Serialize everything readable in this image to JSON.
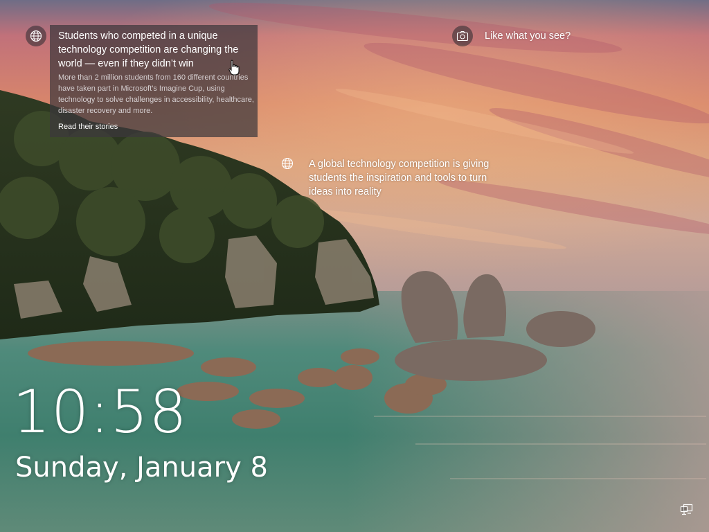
{
  "spotlight": {
    "card": {
      "title": "Students who competed in a unique technology competition are changing the world — even if they didn’t win",
      "body": "More than 2 million students from 160 different countries have taken part in Microsoft’s Imagine Cup, using technology to solve challenges in accessibility, healthcare, disaster recovery and more.",
      "link": "Read their stories",
      "icon": "globe-icon"
    },
    "tip": {
      "text": "A global technology competition is giving students the inspiration and tools to turn ideas into reality",
      "icon": "globe-icon"
    },
    "feedback": {
      "label": "Like what you see?",
      "icon": "camera-icon"
    }
  },
  "clock": {
    "time": "10:58",
    "date": "Sunday, January 8"
  },
  "status": {
    "network_icon": "network-icon"
  }
}
